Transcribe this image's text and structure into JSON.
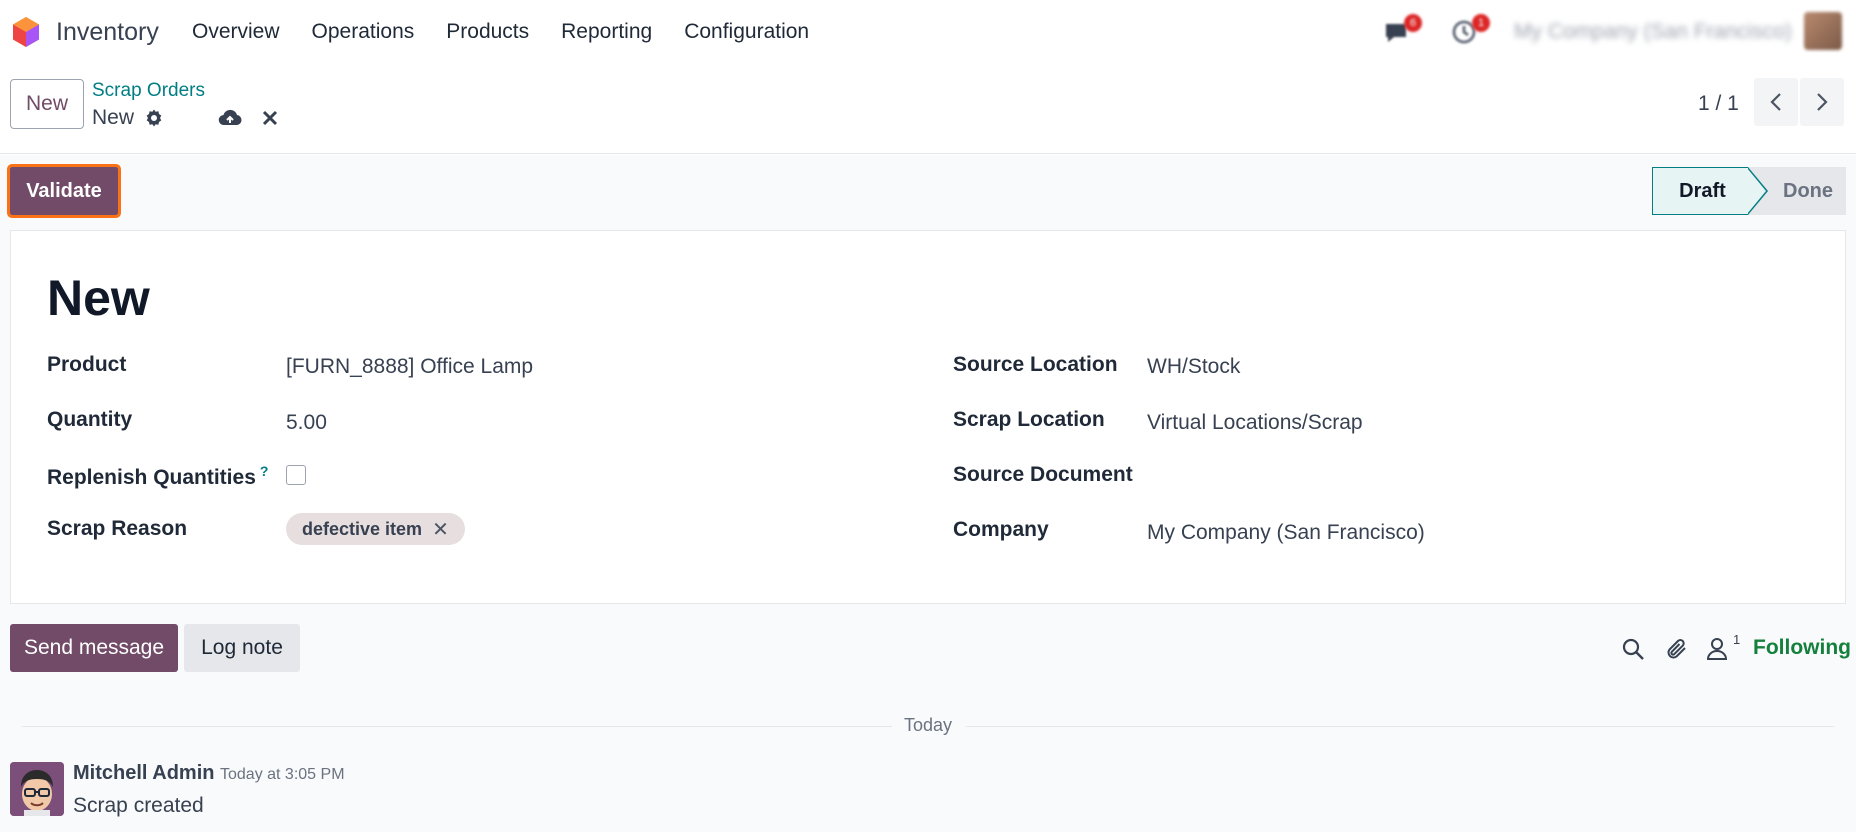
{
  "navbar": {
    "app_name": "Inventory",
    "menu": [
      "Overview",
      "Operations",
      "Products",
      "Reporting",
      "Configuration"
    ],
    "messages_badge": "6",
    "activities_badge": "1",
    "company": "My Company (San Francisco)"
  },
  "control_panel": {
    "new_label": "New",
    "breadcrumb": "Scrap Orders",
    "record_name": "New",
    "pager": "1 / 1"
  },
  "statusbar": {
    "validate_label": "Validate",
    "stages": [
      "Draft",
      "Done"
    ],
    "current_stage": "Draft"
  },
  "form": {
    "title": "New",
    "left": {
      "product_label": "Product",
      "product_value": "[FURN_8888] Office Lamp",
      "quantity_label": "Quantity",
      "quantity_value": "5.00",
      "replenish_label": "Replenish Quantities",
      "replenish_help": "?",
      "replenish_checked": false,
      "reason_label": "Scrap Reason",
      "reason_tag": "defective item"
    },
    "right": {
      "source_location_label": "Source Location",
      "source_location_value": "WH/Stock",
      "scrap_location_label": "Scrap Location",
      "scrap_location_value": "Virtual Locations/Scrap",
      "source_document_label": "Source Document",
      "source_document_value": "",
      "company_label": "Company",
      "company_value": "My Company (San Francisco)"
    }
  },
  "chatter": {
    "send_message_label": "Send message",
    "log_note_label": "Log note",
    "followers_count": "1",
    "following_label": "Following",
    "date_separator": "Today",
    "messages": [
      {
        "author": "Mitchell Admin",
        "time": "Today at 3:05 PM",
        "body": "Scrap created"
      }
    ]
  },
  "colors": {
    "primary": "#714B67",
    "link": "#017e84",
    "following": "#15803d",
    "validate_outline": "#f97316"
  }
}
